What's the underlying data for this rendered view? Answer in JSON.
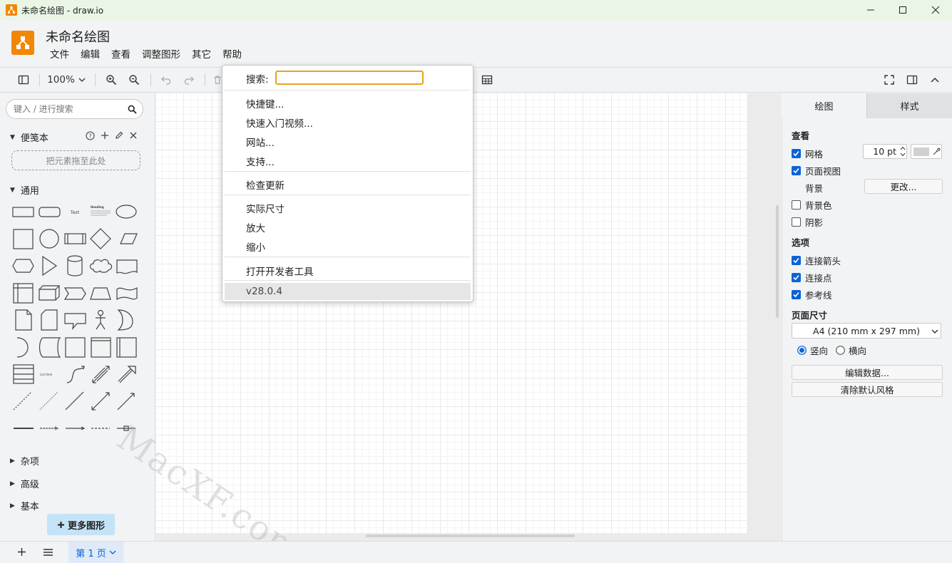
{
  "window": {
    "title": "未命名绘图 - draw.io",
    "minimize": "—",
    "maximize": "☐",
    "close": "✕"
  },
  "document": {
    "title": "未命名绘图"
  },
  "menubar": [
    "文件",
    "编辑",
    "查看",
    "调整图形",
    "其它",
    "帮助"
  ],
  "toolbar": {
    "zoom": "100%"
  },
  "left_panel": {
    "search_placeholder": "键入 / 进行搜索",
    "scratchpad": {
      "label": "便笺本",
      "drop_hint": "把元素拖至此处"
    },
    "general": {
      "label": "通用"
    },
    "collapsed_sections": [
      "杂项",
      "高级",
      "基本"
    ],
    "more_shapes": "更多图形",
    "shape_text_sample": "Text",
    "shape_heading_sample": "Heading",
    "shape_list_sample": "List Item"
  },
  "help_menu": {
    "search_label": "搜索:",
    "search_value": "",
    "items_group1": [
      "快捷键...",
      "快速入门视频...",
      "网站...",
      "支持..."
    ],
    "items_group2": [
      "检查更新"
    ],
    "items_group3": [
      "实际尺寸",
      "放大",
      "缩小"
    ],
    "items_group4": [
      "打开开发者工具"
    ],
    "version": "v28.0.4"
  },
  "right_panel": {
    "tabs": [
      "绘图",
      "样式"
    ],
    "view_header": "查看",
    "grid": {
      "label": "网格",
      "checked": true,
      "size": "10 pt"
    },
    "page_view": {
      "label": "页面视图",
      "checked": true
    },
    "background": {
      "label": "背景",
      "button": "更改..."
    },
    "bg_color": {
      "label": "背景色",
      "checked": false
    },
    "shadow": {
      "label": "阴影",
      "checked": false
    },
    "options_header": "选项",
    "connection_arrows": {
      "label": "连接箭头",
      "checked": true
    },
    "connection_points": {
      "label": "连接点",
      "checked": true
    },
    "guides": {
      "label": "参考线",
      "checked": true
    },
    "page_size_header": "页面尺寸",
    "page_size": "A4 (210 mm x 297 mm)",
    "portrait": "竖向",
    "landscape": "横向",
    "edit_data": "编辑数据...",
    "clear_style": "清除默认风格"
  },
  "bottom_bar": {
    "page_tab": "第 1 页"
  },
  "watermark": "MacXF.com",
  "colors": {
    "accent": "#0a63d8",
    "brand": "#f08705",
    "search_focus": "#e8a41a",
    "titlebar": "#eaf5e6"
  }
}
